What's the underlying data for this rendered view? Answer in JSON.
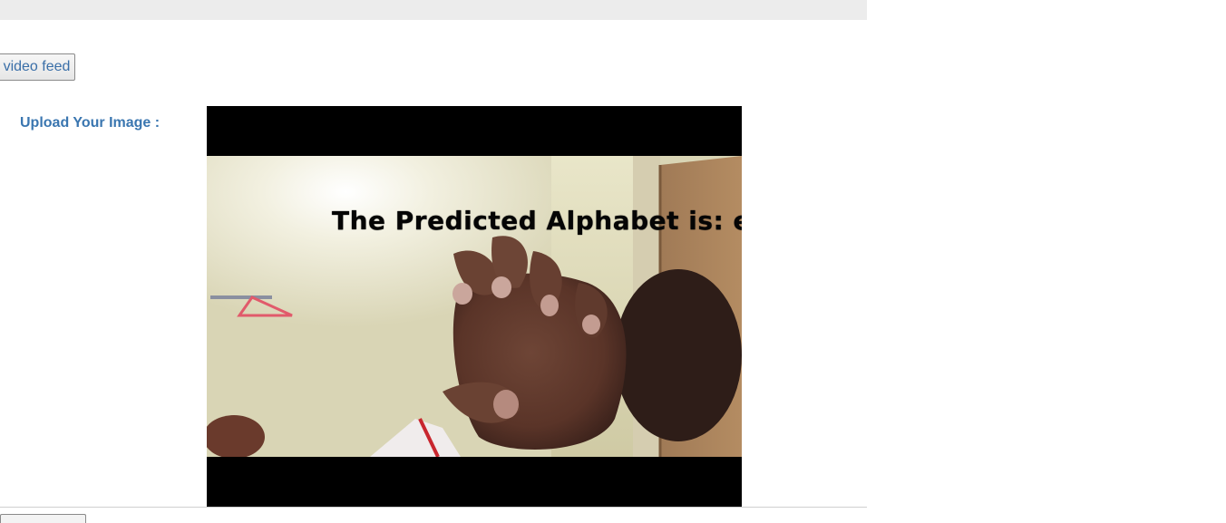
{
  "controls": {
    "video_feed_button": "video feed"
  },
  "upload": {
    "label": "Upload Your Image :"
  },
  "video": {
    "overlay_text": "The Predicted Alphabet is: e"
  }
}
